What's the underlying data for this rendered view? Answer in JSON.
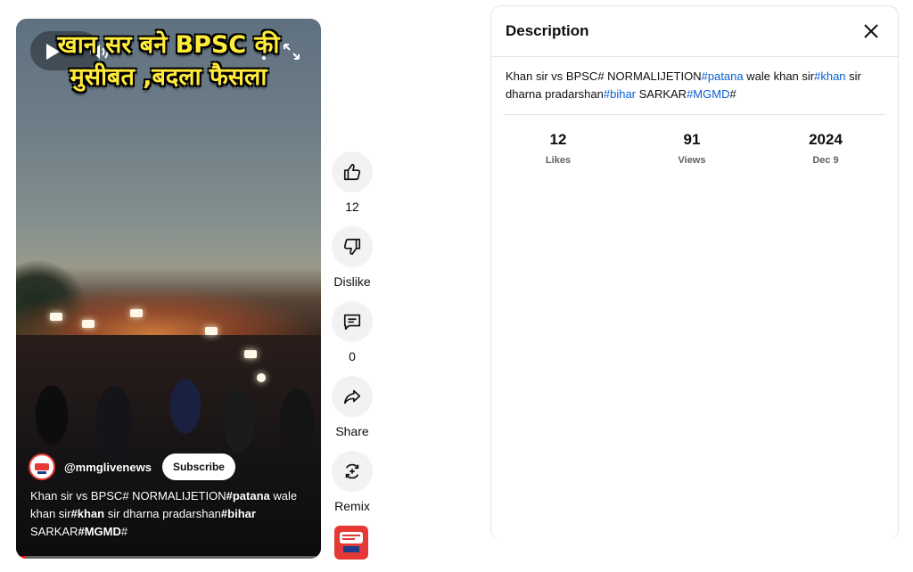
{
  "video": {
    "overlay_title_line1": "खान सर बने BPSC की",
    "overlay_title_line2": "मुसीबत ,बदला फैसला",
    "channel_handle": "@mmglivenews",
    "subscribe_label": "Subscribe",
    "description_parts": [
      {
        "text": "Khan sir vs BPSC# NORMALIJETION",
        "bold": false
      },
      {
        "text": "#patana",
        "bold": true
      },
      {
        "text": " wale khan sir",
        "bold": false
      },
      {
        "text": "#khan",
        "bold": true
      },
      {
        "text": " sir dharna pradarshan",
        "bold": false
      },
      {
        "text": "#bihar",
        "bold": true
      },
      {
        "text": " SARKAR",
        "bold": false
      },
      {
        "text": "#MGMD",
        "bold": true
      },
      {
        "text": "#",
        "bold": false
      }
    ],
    "progress_fraction": 0.03,
    "progress_color": "#ff0000"
  },
  "actions": {
    "like_count": "12",
    "dislike_label": "Dislike",
    "comment_count": "0",
    "share_label": "Share",
    "remix_label": "Remix"
  },
  "panel": {
    "title": "Description",
    "description": {
      "t1": "Khan sir vs BPSC# NORMALIJETION",
      "h1": "#patana",
      "t2": " wale khan sir",
      "h2": "#khan",
      "t3": " sir dharna pradarshan",
      "h3": "#bihar",
      "t4": " SARKAR",
      "h4": "#MGMD",
      "t5": "#"
    },
    "stats": [
      {
        "value": "12",
        "label": "Likes"
      },
      {
        "value": "91",
        "label": "Views"
      },
      {
        "value": "2024",
        "label": "Dec 9"
      }
    ],
    "hashtag_color": "#065fd4"
  },
  "icons": {
    "play": "play-icon",
    "volume": "volume-icon",
    "more": "more-vert-icon",
    "fullscreen": "fullscreen-icon",
    "like": "thumb-up-icon",
    "dislike": "thumb-down-icon",
    "comment": "comment-icon",
    "share": "share-icon",
    "remix": "remix-icon",
    "close": "close-icon"
  }
}
